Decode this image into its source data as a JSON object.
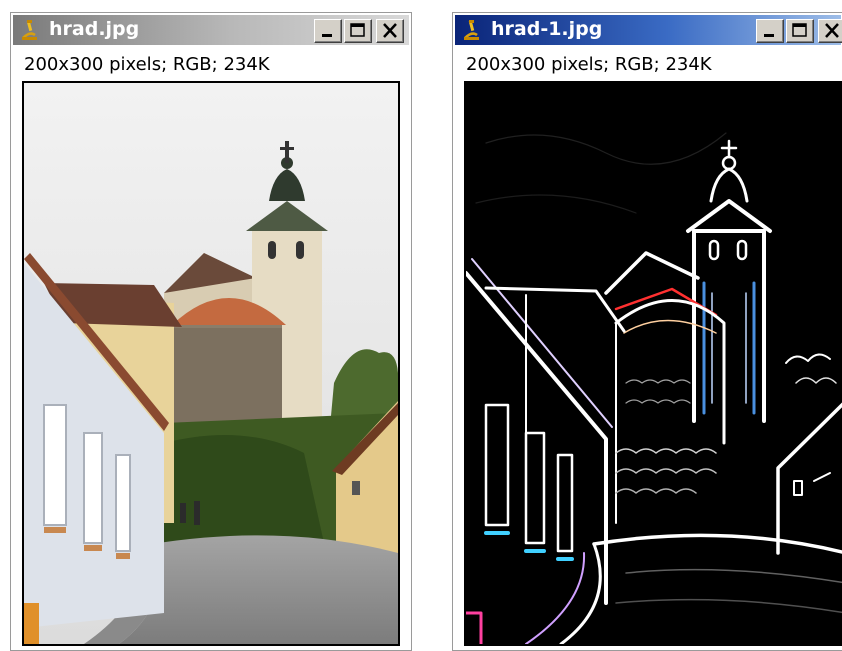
{
  "windows": [
    {
      "title": "hrad.jpg",
      "info": "200x300 pixels; RGB; 234K",
      "icon": "microscope-icon",
      "active": false,
      "titlebar_color": "#9a9a9a",
      "image": "church-tower-street-photo"
    },
    {
      "title": "hrad-1.jpg",
      "info": "200x300 pixels; RGB; 234K",
      "icon": "microscope-icon",
      "active": true,
      "titlebar_color": "#0a2478",
      "image": "edge-detected-church-tower"
    }
  ],
  "window_buttons": [
    "minimize-icon",
    "maximize-icon",
    "close-icon"
  ]
}
